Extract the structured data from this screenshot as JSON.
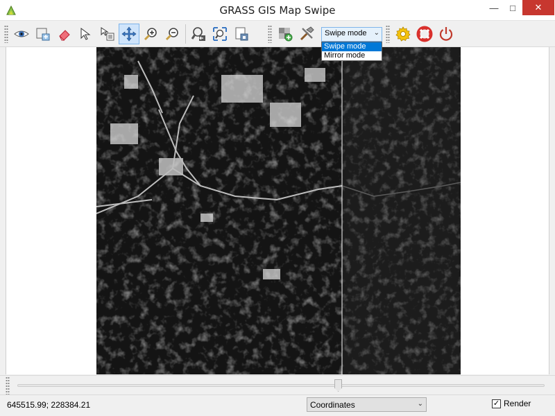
{
  "window": {
    "title": "GRASS GIS Map Swipe",
    "minimize_glyph": "—",
    "maximize_glyph": "□",
    "close_glyph": "✕"
  },
  "toolbar": {
    "tools": [
      {
        "name": "render-map-icon"
      },
      {
        "name": "query-layer-icon"
      },
      {
        "name": "erase-display-icon"
      },
      {
        "name": "pointer-icon"
      },
      {
        "name": "select-query-icon"
      },
      {
        "name": "pan-icon",
        "active": true
      },
      {
        "name": "zoom-in-icon"
      },
      {
        "name": "zoom-out-icon"
      },
      {
        "name": "zoom-back-icon"
      },
      {
        "name": "zoom-extent-icon"
      },
      {
        "name": "save-map-icon"
      }
    ],
    "tools2": [
      {
        "name": "add-raster-icon"
      },
      {
        "name": "tools-icon"
      }
    ],
    "tools3": [
      {
        "name": "settings-gear-icon"
      },
      {
        "name": "help-lifebuoy-icon"
      },
      {
        "name": "quit-power-icon"
      }
    ],
    "mode_select": {
      "value": "Swipe mode",
      "options": [
        "Swipe mode",
        "Mirror mode"
      ]
    }
  },
  "slider": {
    "value_fraction": 0.608
  },
  "statusbar": {
    "coordinates": "645515.99; 228384.21",
    "display_mode": "Coordinates",
    "render_label": "Render",
    "render_checked": "✓"
  },
  "colors": {
    "close_button": "#c7372f",
    "selection_blue": "#0078d7",
    "active_tool": "#cfe4fb",
    "gear_yellow": "#f4c20d",
    "lifebuoy_red": "#d9302c",
    "power_red": "#c0392b"
  }
}
